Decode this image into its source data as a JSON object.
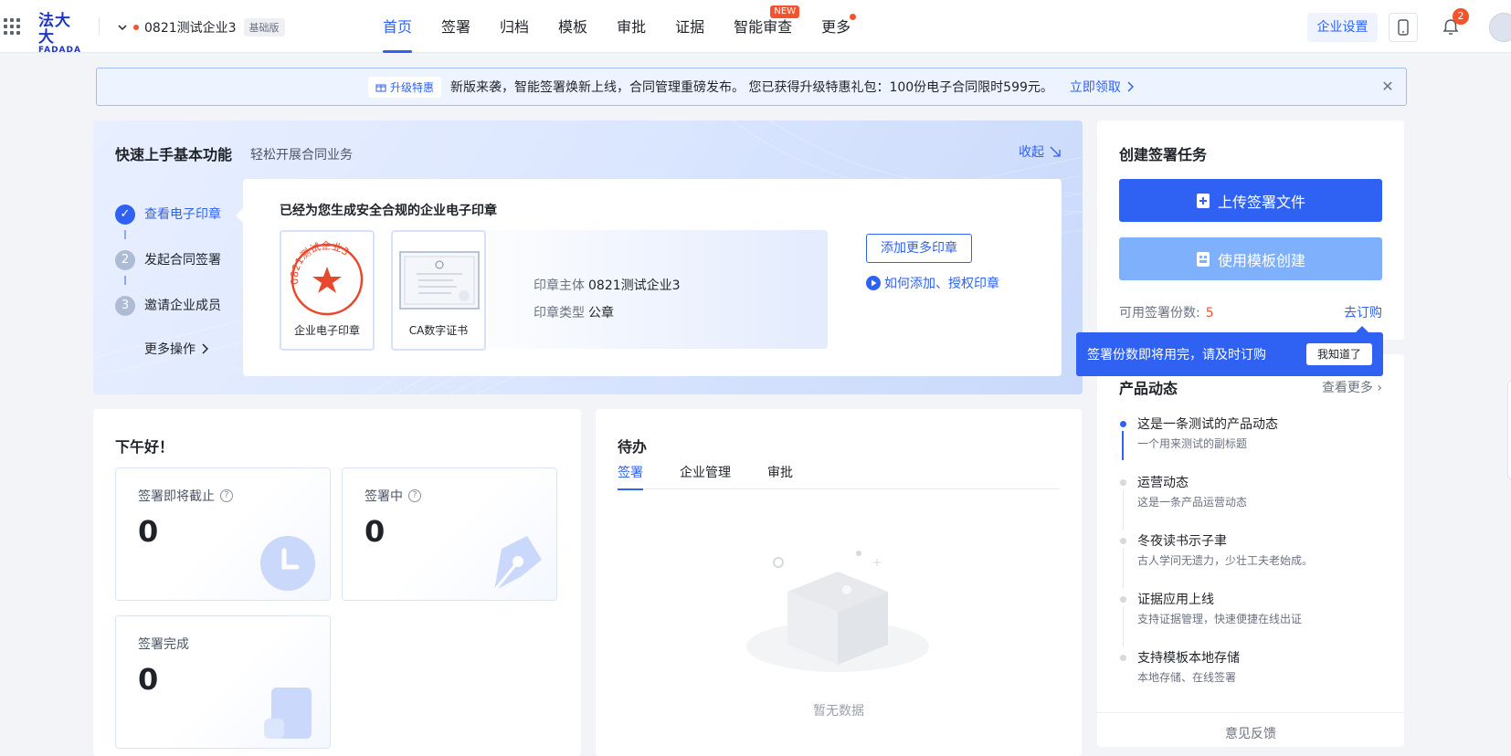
{
  "header": {
    "logo_cn": "法大大",
    "logo_en": "FADADA",
    "org_name": "0821测试企业3",
    "org_badge": "基础版",
    "nav": [
      {
        "label": "首页",
        "active": true
      },
      {
        "label": "签署"
      },
      {
        "label": "归档"
      },
      {
        "label": "模板"
      },
      {
        "label": "审批"
      },
      {
        "label": "证据"
      },
      {
        "label": "智能审查",
        "badge": "NEW"
      },
      {
        "label": "更多",
        "dot": true
      }
    ],
    "enterprise_settings": "企业设置",
    "notification_count": "2"
  },
  "banner": {
    "tag": "升级特惠",
    "text": "新版来袭，智能签署焕新上线，合同管理重磅发布。 您已获得升级特惠礼包：100份电子合同限时599元。",
    "link": "立即领取"
  },
  "quickstart": {
    "title": "快速上手基本功能",
    "subtitle": "轻松开展合同业务",
    "collapse": "收起",
    "steps": [
      {
        "num": "1",
        "label": "查看电子印章",
        "done": true
      },
      {
        "num": "2",
        "label": "发起合同签署"
      },
      {
        "num": "3",
        "label": "邀请企业成员"
      }
    ],
    "more_ops": "更多操作",
    "card_title": "已经为您生成安全合规的企业电子印章",
    "seal1_caption": "企业电子印章",
    "seal2_caption": "CA数字证书",
    "seal_ring_text": "0821测试企业3",
    "subject_key": "印章主体",
    "subject_val": "0821测试企业3",
    "type_key": "印章类型",
    "type_val": "公章",
    "add_more": "添加更多印章",
    "howto": "如何添加、授权印章"
  },
  "create_task": {
    "title": "创建签署任务",
    "upload": "上传签署文件",
    "template": "使用模板创建",
    "quota_label": "可用签署份数:",
    "quota_value": "5",
    "order": "去订购"
  },
  "tip": {
    "text": "签署份数即将用完，请及时订购",
    "ok": "我知道了"
  },
  "news": {
    "title": "产品动态",
    "view_more": "查看更多",
    "items": [
      {
        "title": "这是一条测试的产品动态",
        "sub": "一个用来测试的副标题"
      },
      {
        "title": "运营动态",
        "sub": "这是一条产品运营动态"
      },
      {
        "title": "冬夜读书示子聿",
        "sub": "古人学问无遗力，少壮工夫老始成。"
      },
      {
        "title": "证据应用上线",
        "sub": "支持证据管理，快速便捷在线出证"
      },
      {
        "title": "支持模板本地存储",
        "sub": "本地存储、在线签署"
      }
    ],
    "footer": "意见反馈"
  },
  "greeting": {
    "title": "下午好！",
    "stats": [
      {
        "label": "签署即将截止",
        "value": "0"
      },
      {
        "label": "签署中",
        "value": "0"
      },
      {
        "label": "签署完成",
        "value": "0"
      }
    ]
  },
  "todo": {
    "title": "待办",
    "tabs": [
      "签署",
      "企业管理",
      "审批"
    ],
    "empty": "暂无数据"
  },
  "colors": {
    "primary": "#2f62f3",
    "danger": "#f5532d",
    "seal_red": "#e8482b"
  }
}
